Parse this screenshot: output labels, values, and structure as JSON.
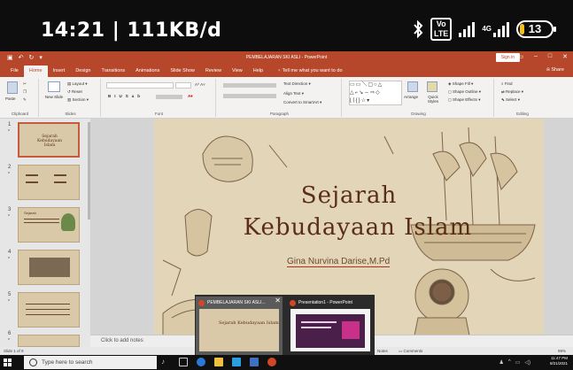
{
  "phone_status": {
    "time": "14:21 | 111KB/d",
    "volte": "Vo\nLTE",
    "network": "4G",
    "battery": "13"
  },
  "window": {
    "title": "PEMBELAJARAN SKI ASLI - PowerPoint",
    "sign_in": "Sign in"
  },
  "ribbon_tabs": [
    "File",
    "Home",
    "Insert",
    "Design",
    "Transitions",
    "Animations",
    "Slide Show",
    "Review",
    "View",
    "Help"
  ],
  "tell_me": "Tell me what you want to do",
  "share": "Share",
  "ribbon": {
    "clipboard": {
      "label": "Clipboard",
      "paste": "Paste"
    },
    "slides": {
      "label": "Slides",
      "new_slide": "New Slide",
      "layout": "Layout",
      "reset": "Reset",
      "section": "Section"
    },
    "font": {
      "label": "Font"
    },
    "paragraph": {
      "label": "Paragraph",
      "text_direction": "Text Direction",
      "align_text": "Align Text",
      "convert": "Convert to SmartArt"
    },
    "drawing": {
      "label": "Drawing",
      "arrange": "Arrange",
      "quick_styles": "Quick Styles",
      "shape_fill": "Shape Fill",
      "shape_outline": "Shape Outline",
      "shape_effects": "Shape Effects"
    },
    "editing": {
      "label": "Editing",
      "find": "Find",
      "replace": "Replace",
      "select": "Select"
    }
  },
  "thumbnails": [
    {
      "num": "1",
      "star": "*",
      "title": "Sejarah Kebudayaan Islam"
    },
    {
      "num": "2",
      "star": "*"
    },
    {
      "num": "3",
      "star": "*",
      "title": "Sejarah"
    },
    {
      "num": "4",
      "star": "*"
    },
    {
      "num": "5",
      "star": "*"
    },
    {
      "num": "6",
      "star": "*"
    }
  ],
  "slide": {
    "title_line1": "Sejarah",
    "title_line2": "Kebudayaan Islam",
    "author": "Gina Nurvina Darise,M.Pd"
  },
  "notes_placeholder": "Click to add notes",
  "status": {
    "slide_of": "Slide 1 of 9",
    "notes": "Notes",
    "comments": "Comments",
    "zoom": "99%"
  },
  "taskbar": {
    "search_placeholder": "Type here to search",
    "clock_time": "11:47 PM",
    "clock_date": "8/21/2021"
  },
  "taskbar_preview": [
    {
      "title": "PEMBELAJARAN SKI ASLI...",
      "close": "✕"
    },
    {
      "title": "Presentation1 - PowerPoint"
    }
  ],
  "colors": {
    "accent": "#b7472a",
    "slide_bg": "#e3d5b8",
    "title_text": "#5a2e14"
  }
}
